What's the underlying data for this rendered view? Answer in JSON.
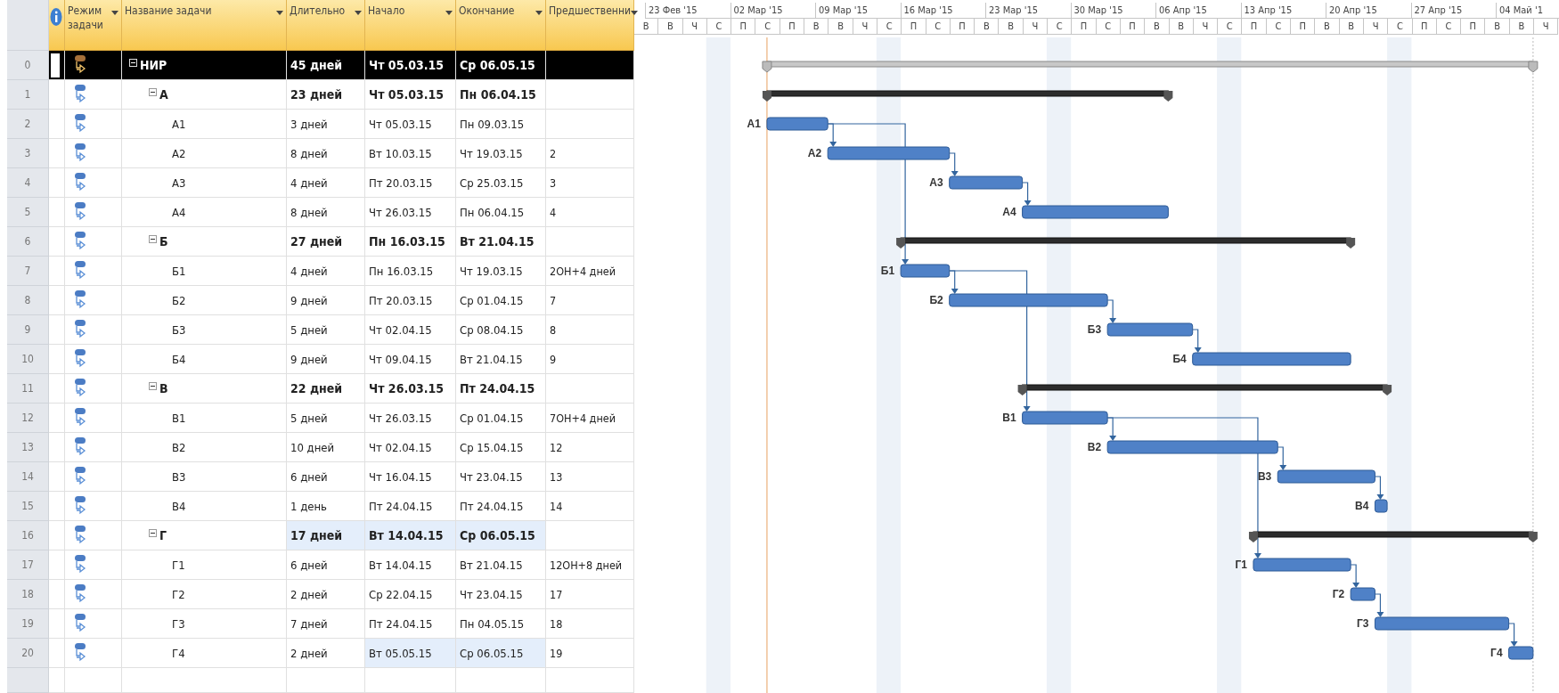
{
  "table": {
    "columns": [
      "Режим задачи",
      "Название задачи",
      "Длительно",
      "Начало",
      "Окончание",
      "Предшественни"
    ]
  },
  "timeline": {
    "weeks": [
      "23 Фев '15",
      "02 Мар '15",
      "09 Мар '15",
      "16 Мар '15",
      "23 Мар '15",
      "30 Мар '15",
      "06 Апр '15",
      "13 Апр '15",
      "20 Апр '15",
      "27 Апр '15",
      "04 Май '1"
    ],
    "days": [
      "В",
      "В",
      "Ч",
      "С",
      "П",
      "С",
      "П",
      "В",
      "В",
      "Ч",
      "С",
      "П",
      "С",
      "П",
      "В",
      "В",
      "Ч",
      "С",
      "П",
      "С",
      "П",
      "В",
      "В",
      "Ч",
      "С",
      "П",
      "С",
      "П",
      "В",
      "В",
      "Ч",
      "С",
      "П",
      "С",
      "П",
      "В",
      "В",
      "Ч"
    ]
  },
  "tasks": [
    {
      "id": "0",
      "name": "НИР",
      "kind": "project",
      "expanded": true,
      "selected": true,
      "duration": "45 дней",
      "start": "Чт 05.03.15",
      "finish": "Ср 06.05.15",
      "changed": {
        "duration": false,
        "start": false,
        "finish": false
      },
      "children": [
        {
          "id": "1",
          "name": "А",
          "kind": "summary",
          "expanded": true,
          "selected": false,
          "duration": "23 дней",
          "start": "Чт 05.03.15",
          "finish": "Пн 06.04.15",
          "changed": {
            "duration": false,
            "start": false,
            "finish": false
          },
          "children": [
            {
              "id": "2",
              "name": "А1",
              "bar_label": "А1",
              "kind": "task",
              "selected": false,
              "duration": "3 дней",
              "start": "Чт 05.03.15",
              "finish": "Пн 09.03.15",
              "changed": {
                "duration": false,
                "start": false,
                "finish": false
              }
            },
            {
              "id": "3",
              "name": "А2",
              "bar_label": "А2",
              "kind": "task",
              "selected": false,
              "duration": "8 дней",
              "start": "Вт 10.03.15",
              "finish": "Чт 19.03.15",
              "predecessors": "2",
              "changed": {
                "duration": false,
                "start": false,
                "finish": false
              }
            },
            {
              "id": "4",
              "name": "А3",
              "bar_label": "А3",
              "kind": "task",
              "selected": false,
              "duration": "4 дней",
              "start": "Пт 20.03.15",
              "finish": "Ср 25.03.15",
              "predecessors": "3",
              "changed": {
                "duration": false,
                "start": false,
                "finish": false
              }
            },
            {
              "id": "5",
              "name": "А4",
              "bar_label": "А4",
              "kind": "task",
              "selected": false,
              "duration": "8 дней",
              "start": "Чт 26.03.15",
              "finish": "Пн 06.04.15",
              "predecessors": "4",
              "changed": {
                "duration": false,
                "start": false,
                "finish": false
              }
            }
          ]
        },
        {
          "id": "6",
          "name": "Б",
          "kind": "summary",
          "expanded": true,
          "selected": false,
          "duration": "27 дней",
          "start": "Пн 16.03.15",
          "finish": "Вт 21.04.15",
          "changed": {
            "duration": false,
            "start": false,
            "finish": false
          },
          "children": [
            {
              "id": "7",
              "name": "Б1",
              "bar_label": "Б1",
              "kind": "task",
              "selected": false,
              "duration": "4 дней",
              "start": "Пн 16.03.15",
              "finish": "Чт 19.03.15",
              "predecessors": "2ОН+4 дней",
              "changed": {
                "duration": false,
                "start": false,
                "finish": false
              }
            },
            {
              "id": "8",
              "name": "Б2",
              "bar_label": "Б2",
              "kind": "task",
              "selected": false,
              "duration": "9 дней",
              "start": "Пт 20.03.15",
              "finish": "Ср 01.04.15",
              "predecessors": "7",
              "changed": {
                "duration": false,
                "start": false,
                "finish": false
              }
            },
            {
              "id": "9",
              "name": "Б3",
              "bar_label": "Б3",
              "kind": "task",
              "selected": false,
              "duration": "5 дней",
              "start": "Чт 02.04.15",
              "finish": "Ср 08.04.15",
              "predecessors": "8",
              "changed": {
                "duration": false,
                "start": false,
                "finish": false
              }
            },
            {
              "id": "10",
              "name": "Б4",
              "bar_label": "Б4",
              "kind": "task",
              "selected": false,
              "duration": "9 дней",
              "start": "Чт 09.04.15",
              "finish": "Вт 21.04.15",
              "predecessors": "9",
              "changed": {
                "duration": false,
                "start": false,
                "finish": false
              }
            }
          ]
        },
        {
          "id": "11",
          "name": "В",
          "kind": "summary",
          "expanded": true,
          "selected": false,
          "duration": "22 дней",
          "start": "Чт 26.03.15",
          "finish": "Пт 24.04.15",
          "changed": {
            "duration": false,
            "start": false,
            "finish": false
          },
          "children": [
            {
              "id": "12",
              "name": "В1",
              "bar_label": "В1",
              "kind": "task",
              "selected": false,
              "duration": "5 дней",
              "start": "Чт 26.03.15",
              "finish": "Ср 01.04.15",
              "predecessors": "7ОН+4 дней",
              "changed": {
                "duration": false,
                "start": false,
                "finish": false
              }
            },
            {
              "id": "13",
              "name": "В2",
              "bar_label": "В2",
              "kind": "task",
              "selected": false,
              "duration": "10 дней",
              "start": "Чт 02.04.15",
              "finish": "Ср 15.04.15",
              "predecessors": "12",
              "changed": {
                "duration": false,
                "start": false,
                "finish": false
              }
            },
            {
              "id": "14",
              "name": "В3",
              "bar_label": "В3",
              "kind": "task",
              "selected": false,
              "duration": "6 дней",
              "start": "Чт 16.04.15",
              "finish": "Чт 23.04.15",
              "predecessors": "13",
              "changed": {
                "duration": false,
                "start": false,
                "finish": false
              }
            },
            {
              "id": "15",
              "name": "В4",
              "bar_label": "В4",
              "kind": "task",
              "selected": false,
              "duration": "1 день",
              "start": "Пт 24.04.15",
              "finish": "Пт 24.04.15",
              "predecessors": "14",
              "changed": {
                "duration": false,
                "start": false,
                "finish": false
              }
            }
          ]
        },
        {
          "id": "16",
          "name": "Г",
          "kind": "summary",
          "expanded": true,
          "selected": false,
          "duration": "17 дней",
          "start": "Вт 14.04.15",
          "finish": "Ср 06.05.15",
          "changed": {
            "duration": true,
            "start": true,
            "finish": true
          },
          "children": [
            {
              "id": "17",
              "name": "Г1",
              "bar_label": "Г1",
              "kind": "task",
              "selected": false,
              "duration": "6 дней",
              "start": "Вт 14.04.15",
              "finish": "Вт 21.04.15",
              "predecessors": "12ОН+8 дней",
              "changed": {
                "duration": false,
                "start": false,
                "finish": false
              }
            },
            {
              "id": "18",
              "name": "Г2",
              "bar_label": "Г2",
              "kind": "task",
              "selected": false,
              "duration": "2 дней",
              "start": "Ср 22.04.15",
              "finish": "Чт 23.04.15",
              "predecessors": "17",
              "changed": {
                "duration": false,
                "start": false,
                "finish": false
              }
            },
            {
              "id": "19",
              "name": "Г3",
              "bar_label": "Г3",
              "kind": "task",
              "selected": false,
              "duration": "7 дней",
              "start": "Пт 24.04.15",
              "finish": "Пн 04.05.15",
              "predecessors": "18",
              "changed": {
                "duration": false,
                "start": false,
                "finish": false
              }
            },
            {
              "id": "20",
              "name": "Г4",
              "bar_label": "Г4",
              "kind": "task",
              "selected": false,
              "duration": "2 дней",
              "start": "Вт 05.05.15",
              "finish": "Ср 06.05.15",
              "predecessors": "19",
              "changed": {
                "duration": false,
                "start": true,
                "finish": true
              }
            }
          ]
        }
      ]
    }
  ]
}
